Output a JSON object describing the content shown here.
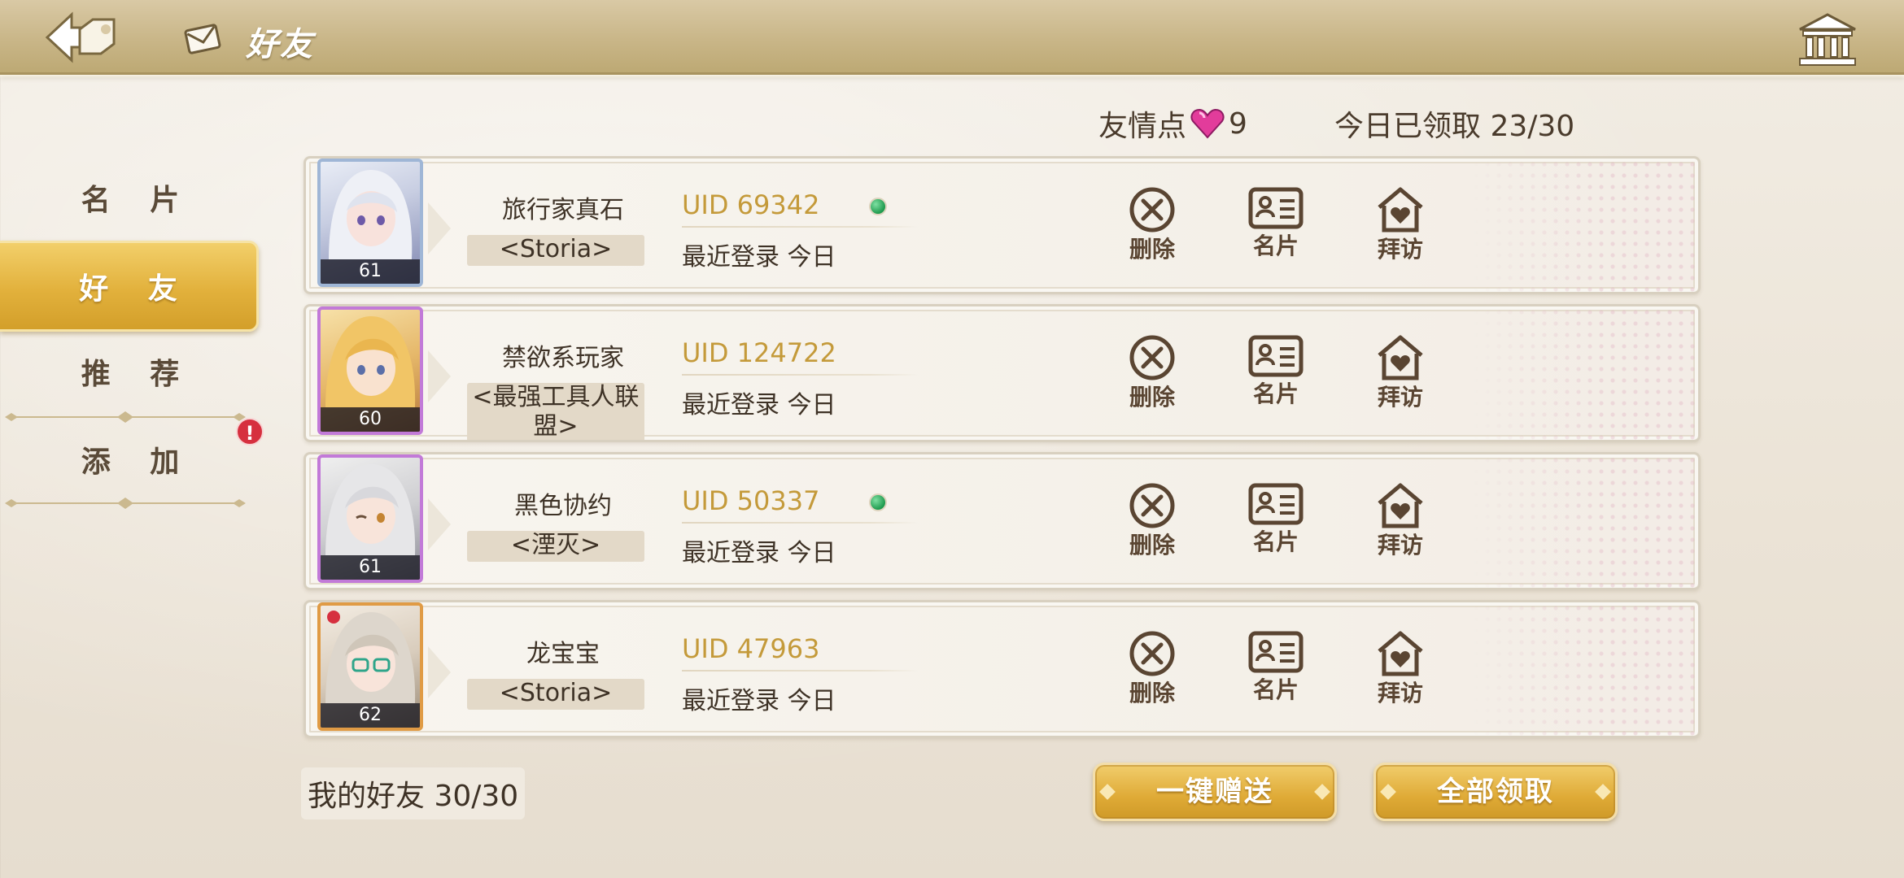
{
  "header": {
    "title": "好友"
  },
  "sidebar": {
    "items": [
      {
        "label": "名 片"
      },
      {
        "label": "好 友"
      },
      {
        "label": "推 荐"
      },
      {
        "label": "添 加"
      }
    ],
    "alert": "!"
  },
  "stats": {
    "friendship_label": "友情点",
    "friendship_value": "9",
    "claimed": "今日已领取 23/30"
  },
  "friends": [
    {
      "name": "旅行家真石",
      "guild": "<Storia>",
      "uid": "UID 69342",
      "last_login": "最近登录 今日",
      "level": "61",
      "online": true
    },
    {
      "name": "禁欲系玩家",
      "guild": "<最强工具人联盟>",
      "uid": "UID 124722",
      "last_login": "最近登录 今日",
      "level": "60",
      "online": false
    },
    {
      "name": "黑色协约",
      "guild": "<湮灭>",
      "uid": "UID 50337",
      "last_login": "最近登录 今日",
      "level": "61",
      "online": true
    },
    {
      "name": "龙宝宝",
      "guild": "<Storia>",
      "uid": "UID 47963",
      "last_login": "最近登录 今日",
      "level": "62",
      "online": false
    }
  ],
  "actions": {
    "delete": "删除",
    "card": "名片",
    "visit": "拜访"
  },
  "footer": {
    "friend_count": "我的好友 30/30",
    "send_all": "一键赠送",
    "claim_all": "全部领取"
  },
  "colors": {
    "accent_gold": "#e2b13c",
    "uid_text": "#c49a3a",
    "online": "#1e9a4e",
    "alert": "#d6303f"
  },
  "icons": [
    "back-arrow-icon",
    "mail-icon",
    "home-icon",
    "heart-gem-icon",
    "delete-x-icon",
    "id-card-icon",
    "house-heart-icon"
  ]
}
